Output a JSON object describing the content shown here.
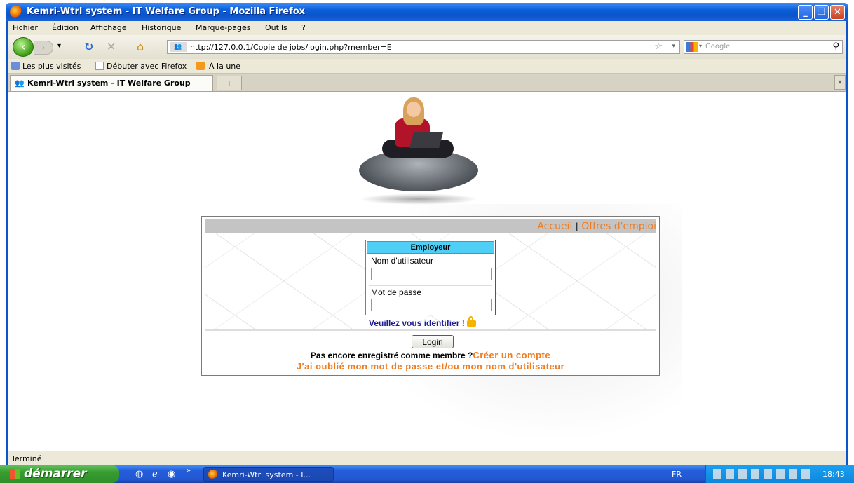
{
  "window": {
    "title": "Kemri-Wtrl system - IT Welfare Group - Mozilla Firefox",
    "buttons": [
      "_",
      "❐",
      "✕"
    ]
  },
  "menu": {
    "items": [
      "Fichier",
      "Édition",
      "Affichage",
      "Historique",
      "Marque-pages",
      "Outils",
      "?"
    ]
  },
  "toolbar": {
    "url": "http://127.0.0.1/Copie de jobs/login.php?member=E",
    "search_placeholder": "Google"
  },
  "bookmarks": {
    "items": [
      "Les plus visités",
      "Débuter avec Firefox",
      "À la une"
    ]
  },
  "tabs": {
    "active_label": "Kemri-Wtrl system - IT Welfare Group"
  },
  "page": {
    "nav": {
      "home_label": "Accueil",
      "separator": "|",
      "jobs_label": "Offres d'emploi"
    },
    "login_panel": {
      "header": "Employeur",
      "username_label": "Nom d'utilisateur",
      "username_value": "",
      "password_label": "Mot de passe",
      "password_value": ""
    },
    "identify_text": "Veuillez vous identifier !",
    "login_button": "Login",
    "register_prompt": "Pas encore enregistré comme membre ?",
    "create_account": "Créer un compte",
    "forgot_link": "J'ai oublié mon mot de passe et/ou mon nom d'utilisateur"
  },
  "status": {
    "text": "Terminé"
  },
  "taskbar": {
    "start_label": "démarrer",
    "task_label": "Kemri-Wtrl system - I...",
    "language": "FR",
    "clock": "18:43"
  },
  "colors": {
    "accent_orange": "#f07c20",
    "panel_header": "#4fcff6",
    "identify_blue": "#1c1c99",
    "title_bar": "#0b54c9"
  }
}
